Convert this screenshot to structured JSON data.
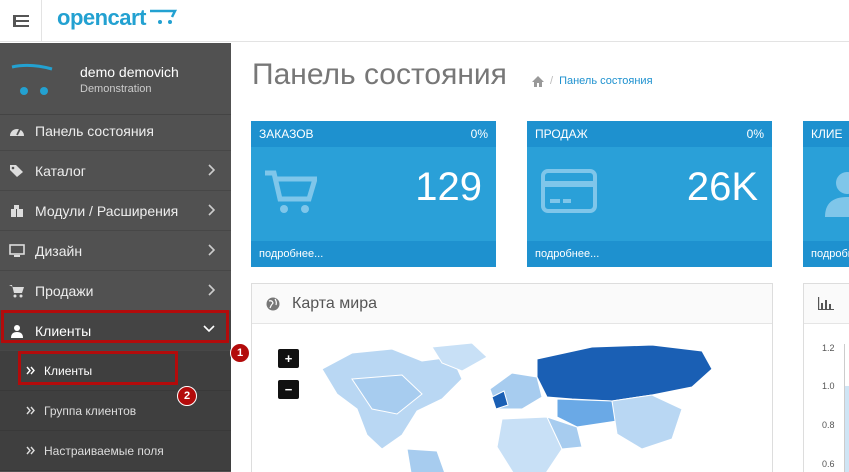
{
  "header": {
    "logo_text": "opencart"
  },
  "profile": {
    "name": "demo demovich",
    "role": "Demonstration"
  },
  "sidebar": {
    "items": [
      {
        "label": "Панель состояния",
        "icon": "dashboard-icon"
      },
      {
        "label": "Каталог",
        "icon": "tags-icon"
      },
      {
        "label": "Модули / Расширения",
        "icon": "puzzle-icon"
      },
      {
        "label": "Дизайн",
        "icon": "desktop-icon"
      },
      {
        "label": "Продажи",
        "icon": "cart-icon"
      },
      {
        "label": "Клиенты",
        "icon": "user-icon"
      }
    ],
    "subitems": [
      {
        "label": "Клиенты"
      },
      {
        "label": "Группа клиентов"
      },
      {
        "label": "Настраиваемые поля"
      }
    ]
  },
  "annotations": {
    "badge1": "1",
    "badge2": "2",
    "color": "#b30b0b"
  },
  "page": {
    "title": "Панель состояния",
    "breadcrumb": "Панель состояния"
  },
  "tiles": [
    {
      "title": "ЗАКАЗОВ",
      "percent": "0%",
      "value": "129",
      "more": "подробнее...",
      "icon": "cart-icon"
    },
    {
      "title": "ПРОДАЖ",
      "percent": "0%",
      "value": "26K",
      "more": "подробнее...",
      "icon": "credit-card-icon"
    },
    {
      "title": "КЛИЕ",
      "percent": "",
      "value": "",
      "more": "подробне",
      "icon": "user-icon"
    }
  ],
  "map": {
    "title": "Карта мира",
    "zoom_in": "+",
    "zoom_out": "−"
  },
  "chart": {
    "yticks": [
      "1.2",
      "1.0",
      "0.8",
      "0.6"
    ]
  },
  "colors": {
    "accent": "#1e91cf",
    "tile": "#2aa0d8",
    "sidebar": "#515151"
  }
}
